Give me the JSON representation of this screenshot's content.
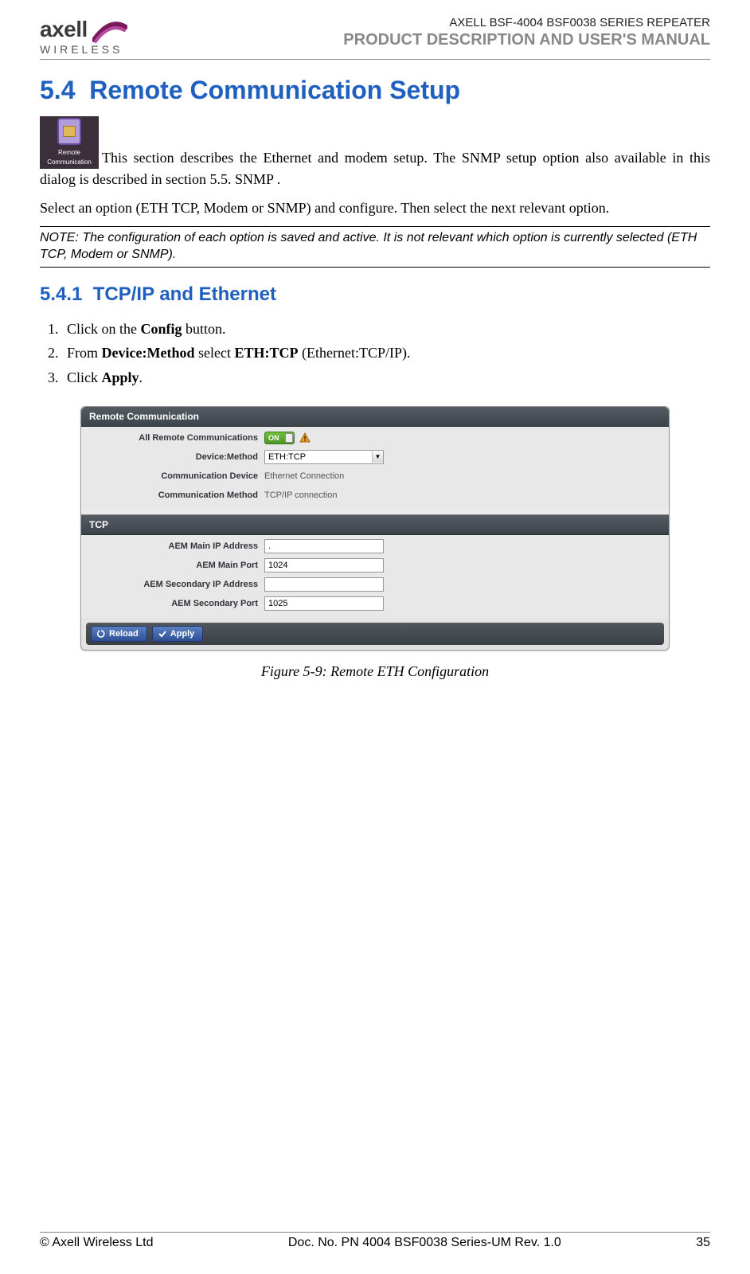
{
  "header": {
    "logo_main": "axell",
    "logo_sub": "WIRELESS",
    "title_line1": "AXELL BSF-4004 BSF0038 SERIES REPEATER",
    "title_line2": "PRODUCT DESCRIPTION AND USER'S MANUAL"
  },
  "section": {
    "number": "5.4",
    "title": "Remote Communication Setup",
    "icon_label_line1": "Remote",
    "icon_label_line2": "Communication",
    "intro_part1": "This section describes the Ethernet and modem setup. The SNMP setup option also available in this dialog is described in section 5.5. SNMP .",
    "intro_part2": "Select an option (ETH TCP, Modem or SNMP) and configure. Then select the next relevant option.",
    "note": "NOTE: The configuration of each option is saved and active. It is not relevant which option is currently selected (ETH TCP, Modem or SNMP)."
  },
  "subsection": {
    "number": "5.4.1",
    "title": "TCP/IP and Ethernet",
    "steps": [
      {
        "pre": "Click on the ",
        "bold": "Config",
        "post": " button."
      },
      {
        "pre": "From ",
        "bold": "Device:Method",
        "mid": " select ",
        "bold2": "ETH:TCP",
        "post": " (Ethernet:TCP/IP)."
      },
      {
        "pre": "Click ",
        "bold": "Apply",
        "post": "."
      }
    ]
  },
  "screenshot": {
    "panel_rc_title": "Remote Communication",
    "rc": {
      "all_comm_label": "All Remote Communications",
      "toggle_state": "ON",
      "device_method_label": "Device:Method",
      "device_method_value": "ETH:TCP",
      "comm_device_label": "Communication Device",
      "comm_device_value": "Ethernet Connection",
      "comm_method_label": "Communication Method",
      "comm_method_value": "TCP/IP connection"
    },
    "panel_tcp_title": "TCP",
    "tcp": {
      "main_ip_label": "AEM Main IP Address",
      "main_ip_value": ".",
      "main_port_label": "AEM Main Port",
      "main_port_value": "1024",
      "sec_ip_label": "AEM Secondary IP Address",
      "sec_ip_value": "",
      "sec_port_label": "AEM Secondary Port",
      "sec_port_value": "1025"
    },
    "buttons": {
      "reload": "Reload",
      "apply": "Apply"
    }
  },
  "figure_caption": "Figure 5-9:  Remote ETH Configuration",
  "footer": {
    "left": "© Axell Wireless Ltd",
    "center": "Doc. No. PN 4004 BSF0038 Series-UM Rev. 1.0",
    "right": "35"
  }
}
